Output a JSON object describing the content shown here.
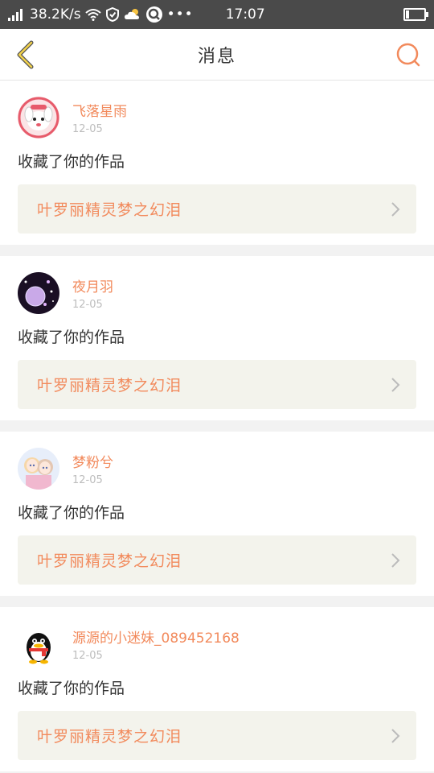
{
  "status_bar": {
    "net_speed": "38.2K/s",
    "time": "17:07"
  },
  "header": {
    "title": "消息",
    "back_icon": "chevron-left-icon",
    "search_icon": "search-icon",
    "accent_color": "#f28a5c"
  },
  "messages": [
    {
      "user": "飞落星雨",
      "date": "12-05",
      "action": "收藏了你的作品",
      "work": "叶罗丽精灵梦之幻泪"
    },
    {
      "user": "夜月羽",
      "date": "12-05",
      "action": "收藏了你的作品",
      "work": "叶罗丽精灵梦之幻泪"
    },
    {
      "user": "梦粉兮",
      "date": "12-05",
      "action": "收藏了你的作品",
      "work": "叶罗丽精灵梦之幻泪"
    },
    {
      "user": "源源的小迷妹_089452168",
      "date": "12-05",
      "action": "收藏了你的作品",
      "work": "叶罗丽精灵梦之幻泪"
    }
  ]
}
